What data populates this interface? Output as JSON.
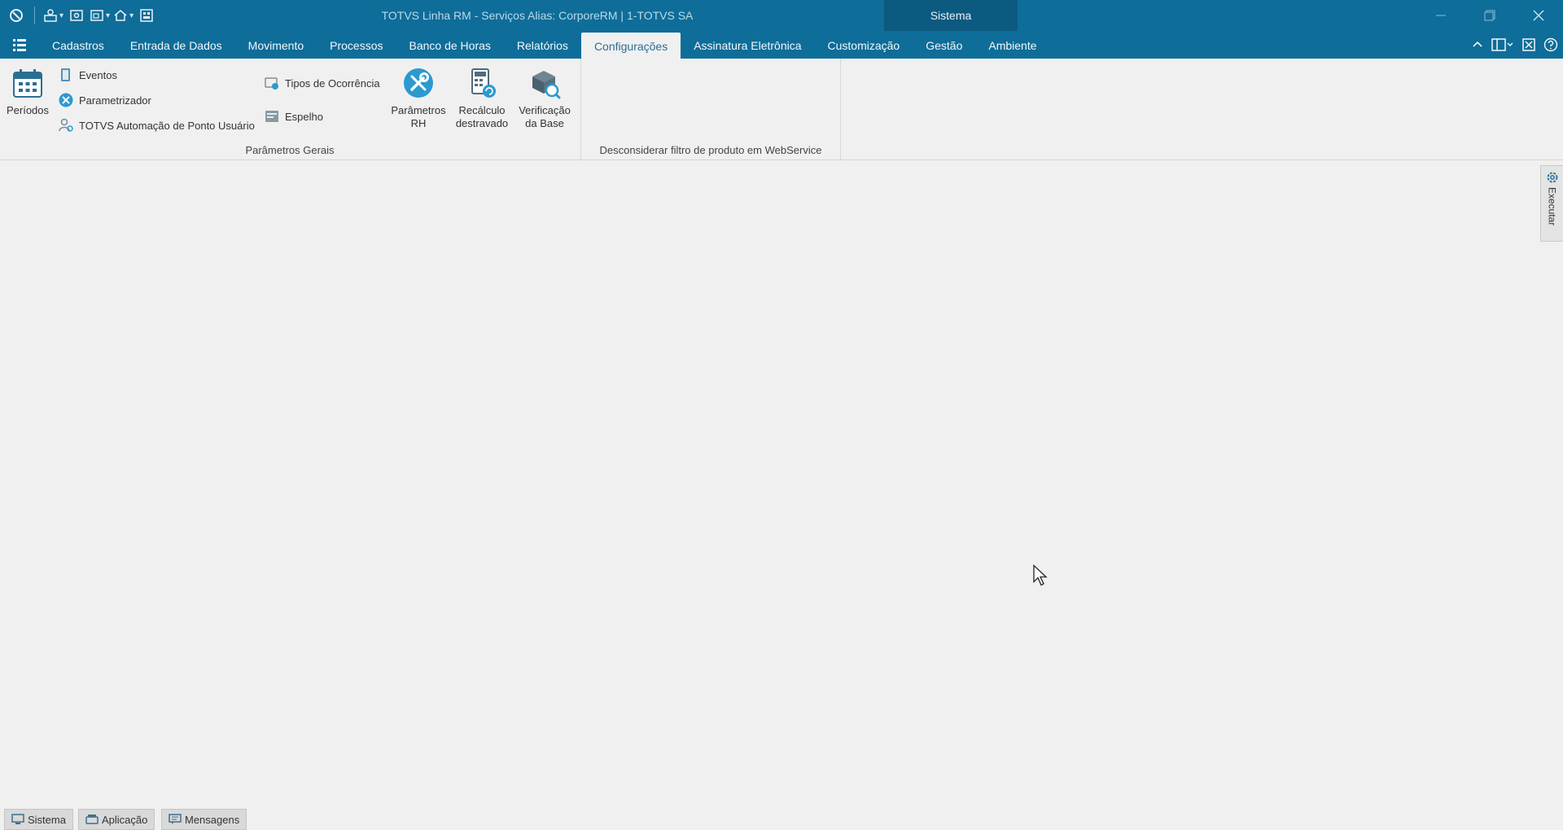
{
  "window": {
    "title": "TOTVS Linha RM - Serviços  Alias: CorporeRM | 1-TOTVS SA",
    "context_tab": "Sistema"
  },
  "menu": {
    "tabs": [
      {
        "label": "Cadastros"
      },
      {
        "label": "Entrada de Dados"
      },
      {
        "label": "Movimento"
      },
      {
        "label": "Processos"
      },
      {
        "label": "Banco de Horas"
      },
      {
        "label": "Relatórios"
      },
      {
        "label": "Configurações",
        "active": true
      },
      {
        "label": "Assinatura Eletrônica"
      },
      {
        "label": "Customização"
      },
      {
        "label": "Gestão"
      },
      {
        "label": "Ambiente"
      }
    ]
  },
  "ribbon": {
    "periodos": "Períodos",
    "eventos": "Eventos",
    "parametrizador": "Parametrizador",
    "automacao": "TOTVS Automação de Ponto Usuário",
    "tipos_ocorrencia": "Tipos de Ocorrência",
    "espelho": "Espelho",
    "parametros_rh_1": "Parâmetros",
    "parametros_rh_2": "RH",
    "recalculo_1": "Recálculo",
    "recalculo_2": "destravado",
    "verificacao_1": "Verificação",
    "verificacao_2": "da Base",
    "group1_label": "Parâmetros Gerais",
    "group2_label": "Desconsiderar filtro de produto em WebService"
  },
  "side_panel": {
    "executar": "Executar"
  },
  "statusbar": {
    "sistema": "Sistema",
    "aplicacao": "Aplicação",
    "mensagens": "Mensagens"
  },
  "colors": {
    "title_bar": "#0e6d99",
    "context_tab": "#0c5a80",
    "accent_icon": "#2a9ad0",
    "background": "#f0f0f0"
  }
}
